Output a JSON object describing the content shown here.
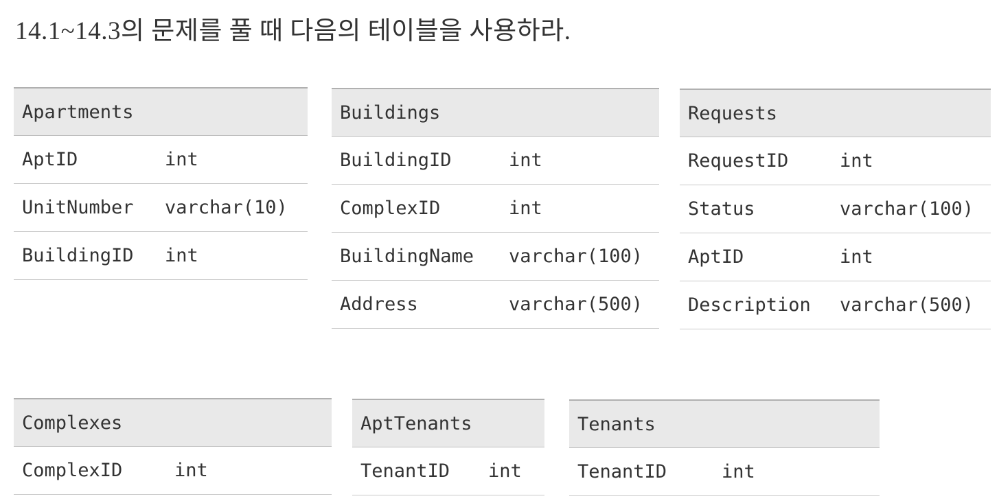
{
  "title": "14.1~14.3의 문제를 풀 때 다음의 테이블을 사용하라.",
  "tables": [
    {
      "name": "Apartments",
      "rows": [
        {
          "field": "AptID",
          "type": "int"
        },
        {
          "field": "UnitNumber",
          "type": "varchar(10)"
        },
        {
          "field": "BuildingID",
          "type": "int"
        }
      ]
    },
    {
      "name": "Buildings",
      "rows": [
        {
          "field": "BuildingID",
          "type": "int"
        },
        {
          "field": "ComplexID",
          "type": "int"
        },
        {
          "field": "BuildingName",
          "type": "varchar(100)"
        },
        {
          "field": "Address",
          "type": "varchar(500)"
        }
      ]
    },
    {
      "name": "Requests",
      "rows": [
        {
          "field": "RequestID",
          "type": "int"
        },
        {
          "field": "Status",
          "type": "varchar(100)"
        },
        {
          "field": "AptID",
          "type": "int"
        },
        {
          "field": "Description",
          "type": "varchar(500)"
        }
      ]
    },
    {
      "name": "Complexes",
      "rows": [
        {
          "field": "ComplexID",
          "type": "int"
        }
      ]
    },
    {
      "name": "AptTenants",
      "rows": [
        {
          "field": "TenantID",
          "type": "int"
        }
      ]
    },
    {
      "name": "Tenants",
      "rows": [
        {
          "field": "TenantID",
          "type": "int"
        }
      ]
    }
  ]
}
